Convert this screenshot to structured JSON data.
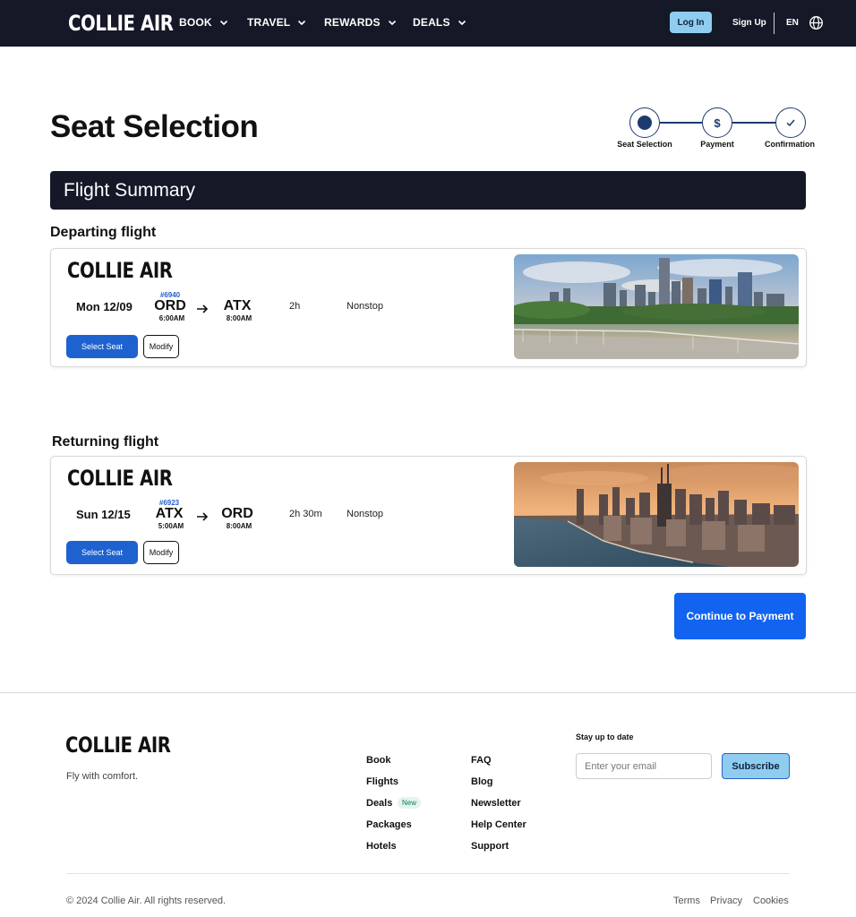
{
  "header": {
    "logo": "COLLIE AIR",
    "nav": [
      "BOOK",
      "TRAVEL",
      "REWARDS",
      "DEALS"
    ],
    "login_label": "Log In",
    "signup_label": "Sign Up",
    "language": "EN",
    "globe_icon": "globe-icon"
  },
  "page": {
    "title": "Seat Selection",
    "steps": [
      {
        "label": "Seat Selection",
        "state": "current"
      },
      {
        "label": "Payment",
        "symbol": "$"
      },
      {
        "label": "Confirmation",
        "symbol": "✓"
      }
    ],
    "summary_title": "Flight Summary"
  },
  "departing": {
    "section_title": "Departing flight",
    "airline": "COLLIE AIR",
    "date": "Mon 12/09",
    "flight_number": "#6940",
    "from_code": "ORD",
    "from_time": "6:00AM",
    "to_code": "ATX",
    "to_time": "8:00AM",
    "duration": "2h",
    "stops": "Nonstop",
    "select_label": "Select Seat",
    "modify_label": "Modify",
    "image": "austin-skyline-photo"
  },
  "returning": {
    "section_title": "Returning flight",
    "airline": "COLLIE AIR",
    "date": "Sun 12/15",
    "flight_number": "#6923",
    "from_code": "ATX",
    "from_time": "5:00AM",
    "to_code": "ORD",
    "to_time": "8:00AM",
    "duration": "2h 30m",
    "stops": "Nonstop",
    "select_label": "Select Seat",
    "modify_label": "Modify",
    "image": "chicago-skyline-photo"
  },
  "continue_label": "Continue to Payment",
  "footer": {
    "logo": "COLLIE AIR",
    "tagline": "Fly with comfort.",
    "col1": [
      "Book",
      "Flights",
      "Deals",
      "Packages",
      "Hotels"
    ],
    "new_badge": "New",
    "col2": [
      "FAQ",
      "Blog",
      "Newsletter",
      "Help Center",
      "Support"
    ],
    "stay_title": "Stay up to date",
    "email_placeholder": "Enter your email",
    "subscribe_label": "Subscribe",
    "copyright": "© 2024 Collie Air. All rights reserved.",
    "legal": [
      "Terms",
      "Privacy",
      "Cookies"
    ]
  },
  "colors": {
    "header_bg": "#141827",
    "primary_blue": "#1e62d0",
    "continue_blue": "#1163f0",
    "light_blue": "#8ecdf0",
    "stepper": "#1d3a6e"
  }
}
